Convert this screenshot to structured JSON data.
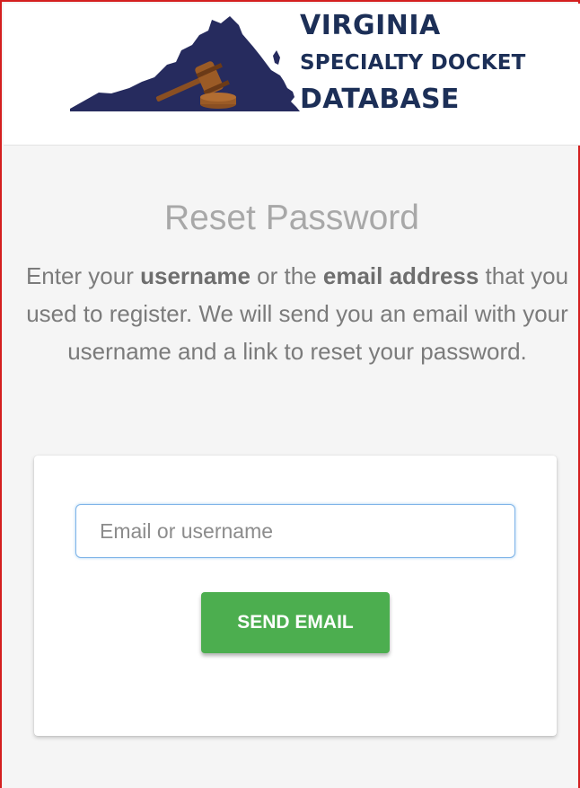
{
  "header": {
    "logo": {
      "icon": "virginia-map-gavel-icon",
      "line1": "VIRGINIA",
      "line2": "SPECIALTY DOCKET",
      "line3": "DATABASE",
      "color": "#1c2f57"
    }
  },
  "main": {
    "title": "Reset Password",
    "instructions": {
      "part1": "Enter your ",
      "bold1": "username",
      "part2": " or the ",
      "bold2": "email address",
      "part3": " that you used to register. We will send you an email with your username and a link to reset your password."
    },
    "form": {
      "input_value": "",
      "input_placeholder": "Email or username",
      "send_label": "SEND EMAIL",
      "button_color": "#4cae4f"
    }
  }
}
